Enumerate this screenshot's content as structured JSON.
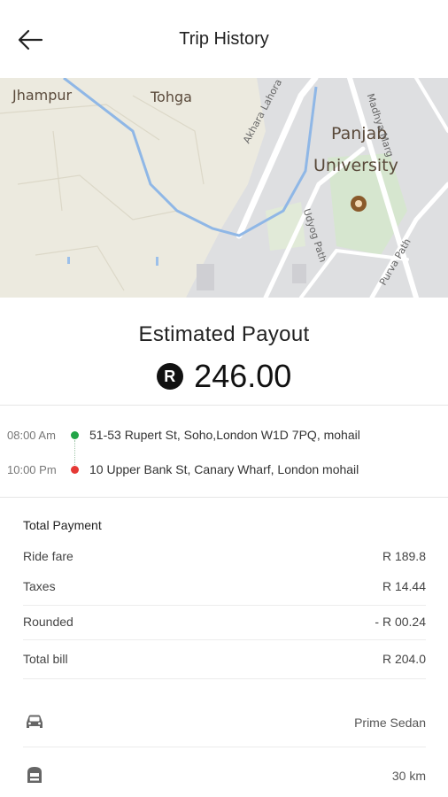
{
  "header": {
    "title": "Trip History",
    "back_icon": "arrow-left-icon"
  },
  "map": {
    "labels": {
      "jhampur": "Jhampur",
      "tohga": "Tohga",
      "panjab": "Panjab",
      "university": "University",
      "road1": "Akhara Lahora Rd",
      "road2": "Madhya Marg",
      "road3": "Udyog Path",
      "road4": "Purva Path"
    }
  },
  "payout": {
    "title": "Estimated Payout",
    "currency_symbol": "R",
    "amount": "246.00"
  },
  "route": {
    "pickup": {
      "time": "08:00 Am",
      "address": "51-53 Rupert St, Soho,London W1D 7PQ, mohail",
      "color": "#22a447"
    },
    "dropoff": {
      "time": "10:00 Pm",
      "address": "10 Upper Bank St, Canary Wharf, London mohail",
      "color": "#e53935"
    }
  },
  "payment": {
    "title": "Total Payment",
    "rows": [
      {
        "label": "Ride fare",
        "value": "R 189.8"
      },
      {
        "label": "Taxes",
        "value": "R 14.44"
      },
      {
        "label": "Rounded",
        "value": "- R 00.24"
      },
      {
        "label": "Total bill",
        "value": "R 204.0"
      }
    ]
  },
  "trip_info": [
    {
      "icon": "car-icon",
      "value": "Prime Sedan"
    },
    {
      "icon": "road-icon",
      "value": "30 km"
    }
  ]
}
